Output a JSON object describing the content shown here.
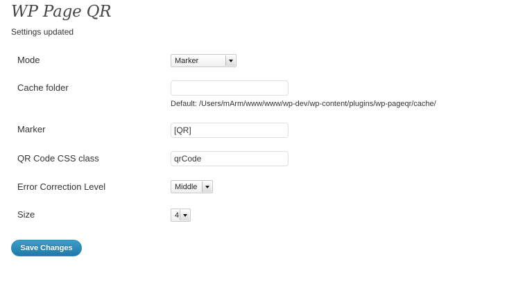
{
  "page": {
    "title": "WP Page QR",
    "notice": "Settings updated"
  },
  "form": {
    "mode": {
      "label": "Mode",
      "value": "Marker"
    },
    "cache_folder": {
      "label": "Cache folder",
      "value": "",
      "hint": "Default: /Users/mArm/www/www/wp-dev/wp-content/plugins/wp-pageqr/cache/"
    },
    "marker": {
      "label": "Marker",
      "value": "[QR]"
    },
    "css_class": {
      "label": "QR Code CSS class",
      "value": "qrCode"
    },
    "error_correction": {
      "label": "Error Correction Level",
      "value": "Middle"
    },
    "size": {
      "label": "Size",
      "value": "4"
    }
  },
  "actions": {
    "save_label": "Save Changes"
  },
  "colors": {
    "button_blue": "#2079a8",
    "title_gray": "#464646"
  }
}
